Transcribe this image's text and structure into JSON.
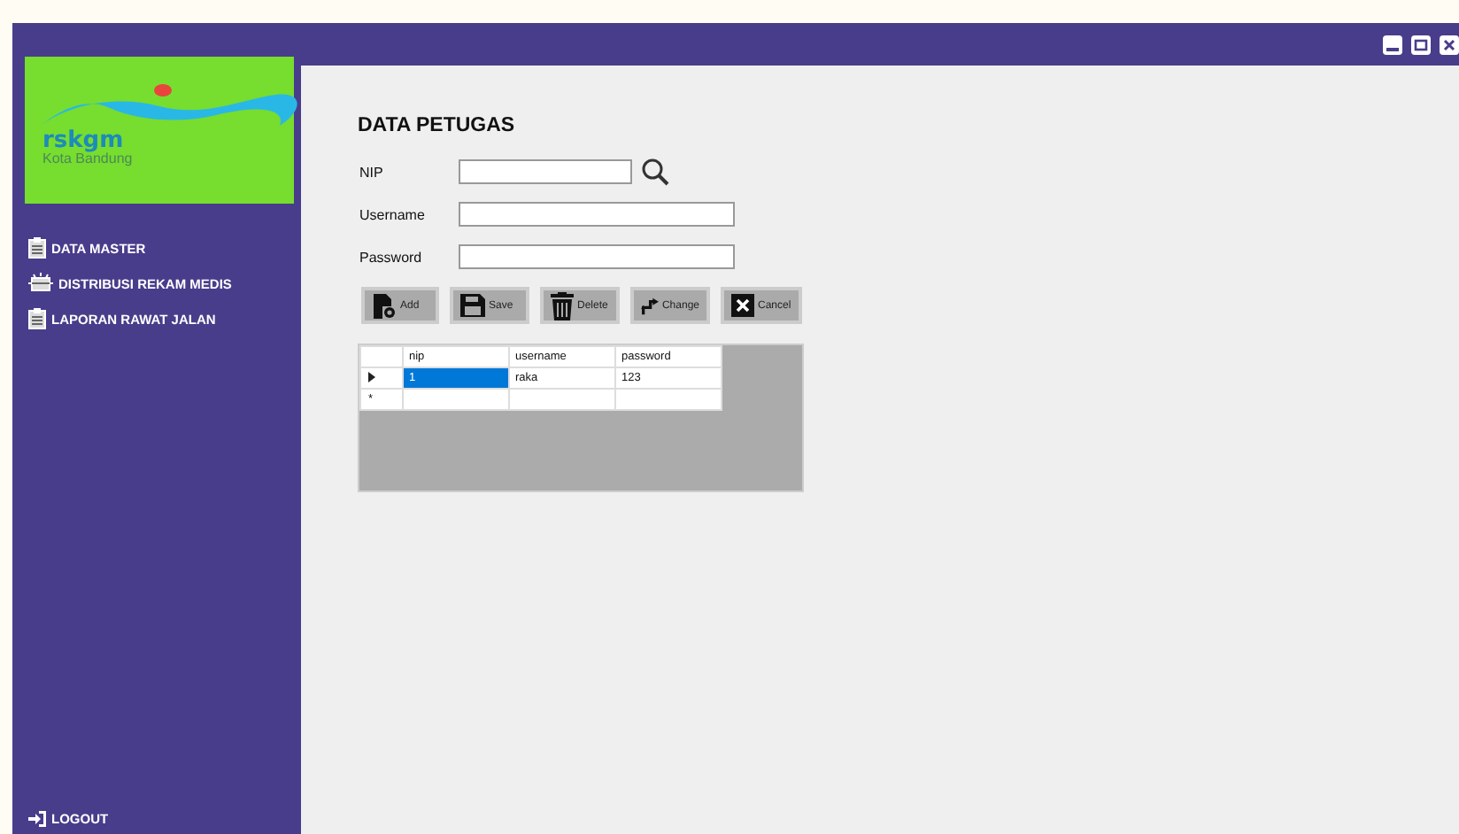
{
  "sidebar": {
    "logo": {
      "name": "rskgm",
      "subtitle": "Kota Bandung"
    },
    "items": [
      {
        "label": "DATA MASTER",
        "kind": "clipboard"
      },
      {
        "label": "DISTRIBUSI REKAM MEDIS",
        "kind": "tray"
      },
      {
        "label": "LAPORAN RAWAT JALAN",
        "kind": "clipboard"
      }
    ],
    "logout": "LOGOUT"
  },
  "form": {
    "title": "DATA PETUGAS",
    "fields": [
      {
        "label": "NIP",
        "kind": "search"
      },
      {
        "label": "Username",
        "kind": "text"
      },
      {
        "label": "Password",
        "kind": "text"
      }
    ],
    "buttons": [
      {
        "label": "Add",
        "kind": "add"
      },
      {
        "label": "Save",
        "kind": "save"
      },
      {
        "label": "Delete",
        "kind": "delete"
      },
      {
        "label": "Change",
        "kind": "change"
      },
      {
        "label": "Cancel",
        "kind": "cancel"
      }
    ]
  },
  "table": {
    "columns": [
      "nip",
      "username",
      "password"
    ],
    "rows": [
      {
        "kind": "current",
        "cells": [
          {
            "text": "1",
            "selected": true
          },
          {
            "text": "raka",
            "selected": false
          },
          {
            "text": "123",
            "selected": false
          }
        ]
      },
      {
        "kind": "new",
        "marker_text": "*",
        "cells": [
          {
            "text": "",
            "selected": false
          },
          {
            "text": "",
            "selected": false
          },
          {
            "text": "",
            "selected": false
          }
        ]
      }
    ]
  }
}
